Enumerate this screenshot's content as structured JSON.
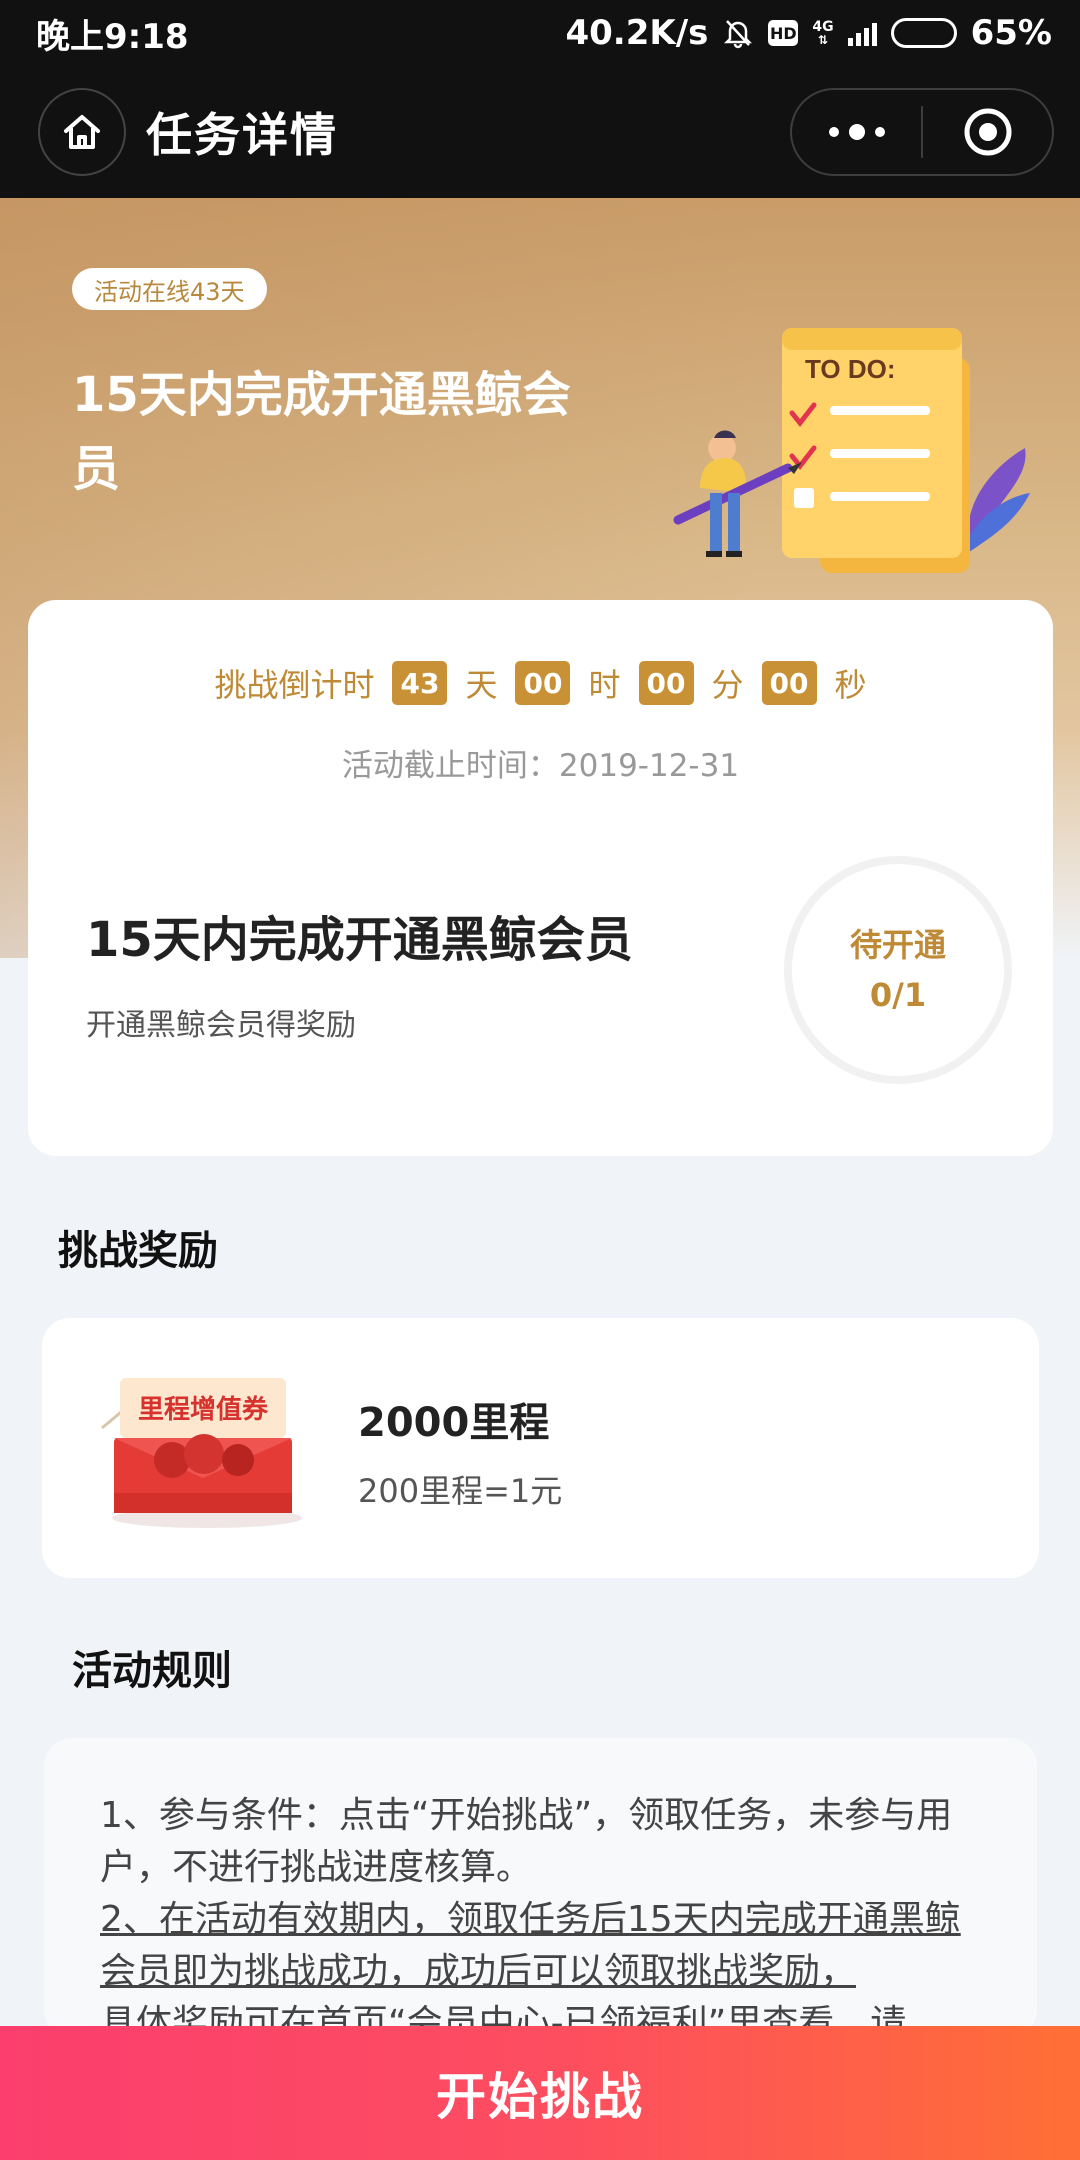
{
  "status_bar": {
    "time": "晚上9:18",
    "network_speed": "40.2K/s",
    "hd_label": "HD",
    "network_type": "4G",
    "battery": "65%",
    "battery_level": 0.65
  },
  "nav": {
    "title": "任务详情",
    "home_icon": "home-icon",
    "more_icon": "more-dots-icon",
    "close_icon": "target-close-icon"
  },
  "hero": {
    "online_badge": "活动在线43天",
    "title": "15天内完成开通黑鲸会员",
    "illustration_text": "TO DO:"
  },
  "countdown": {
    "label": "挑战倒计时",
    "days": "43",
    "days_unit": "天",
    "hours": "00",
    "hours_unit": "时",
    "minutes": "00",
    "minutes_unit": "分",
    "seconds": "00",
    "seconds_unit": "秒",
    "deadline": "活动截止时间：2019-12-31"
  },
  "task": {
    "title": "15天内完成开通黑鲸会员",
    "description": "开通黑鲸会员得奖励",
    "status": "待开通",
    "progress": "0/1"
  },
  "reward": {
    "section_title": "挑战奖励",
    "coupon_label": "里程增值券",
    "name": "2000里程",
    "rate": "200里程=1元"
  },
  "rules": {
    "section_title": "活动规则",
    "rule1": "1、参与条件：点击“开始挑战”，领取任务，未参与用户，不进行挑战进度核算。",
    "rule2": "2、在活动有效期内，领取任务后15天内完成开通黑鲸会员即为挑战成功，成功后可以领取挑战奖励，",
    "rule3": "具体奖励可在首页“会员中心-已领福利”里查看，请"
  },
  "actions": {
    "start_label": "开始挑战"
  },
  "colors": {
    "accent_gold": "#c89136",
    "button_start": "#fb3e6e",
    "button_end": "#ff6f35"
  }
}
